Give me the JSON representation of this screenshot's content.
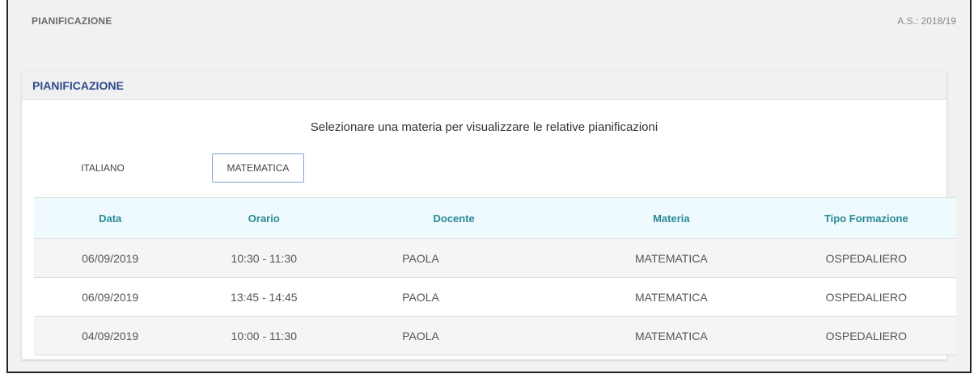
{
  "header": {
    "title": "PIANIFICAZIONE",
    "school_year": "A.S.: 2018/19"
  },
  "card": {
    "title": "PIANIFICAZIONE",
    "instruction": "Selezionare una materia per visualizzare le relative pianificazioni",
    "subjects": [
      "ITALIANO",
      "MATEMATICA"
    ],
    "selected_subject": "MATEMATICA"
  },
  "table": {
    "columns": [
      "Data",
      "Orario",
      "Docente",
      "Materia",
      "Tipo Formazione"
    ],
    "rows": [
      {
        "data": "06/09/2019",
        "orario": "10:30 - 11:30",
        "docente": "PAOLA",
        "materia": "MATEMATICA",
        "tipo": "OSPEDALIERO"
      },
      {
        "data": "06/09/2019",
        "orario": "13:45 - 14:45",
        "docente": "PAOLA",
        "materia": "MATEMATICA",
        "tipo": "OSPEDALIERO"
      },
      {
        "data": "04/09/2019",
        "orario": "10:00 - 11:30",
        "docente": "PAOLA",
        "materia": "MATEMATICA",
        "tipo": "OSPEDALIERO"
      }
    ]
  },
  "colors": {
    "card_title": "#2e4a8c",
    "table_header_text": "#2a8a96",
    "table_header_bg": "#eefafd",
    "selected_border": "#7fa3d6"
  }
}
